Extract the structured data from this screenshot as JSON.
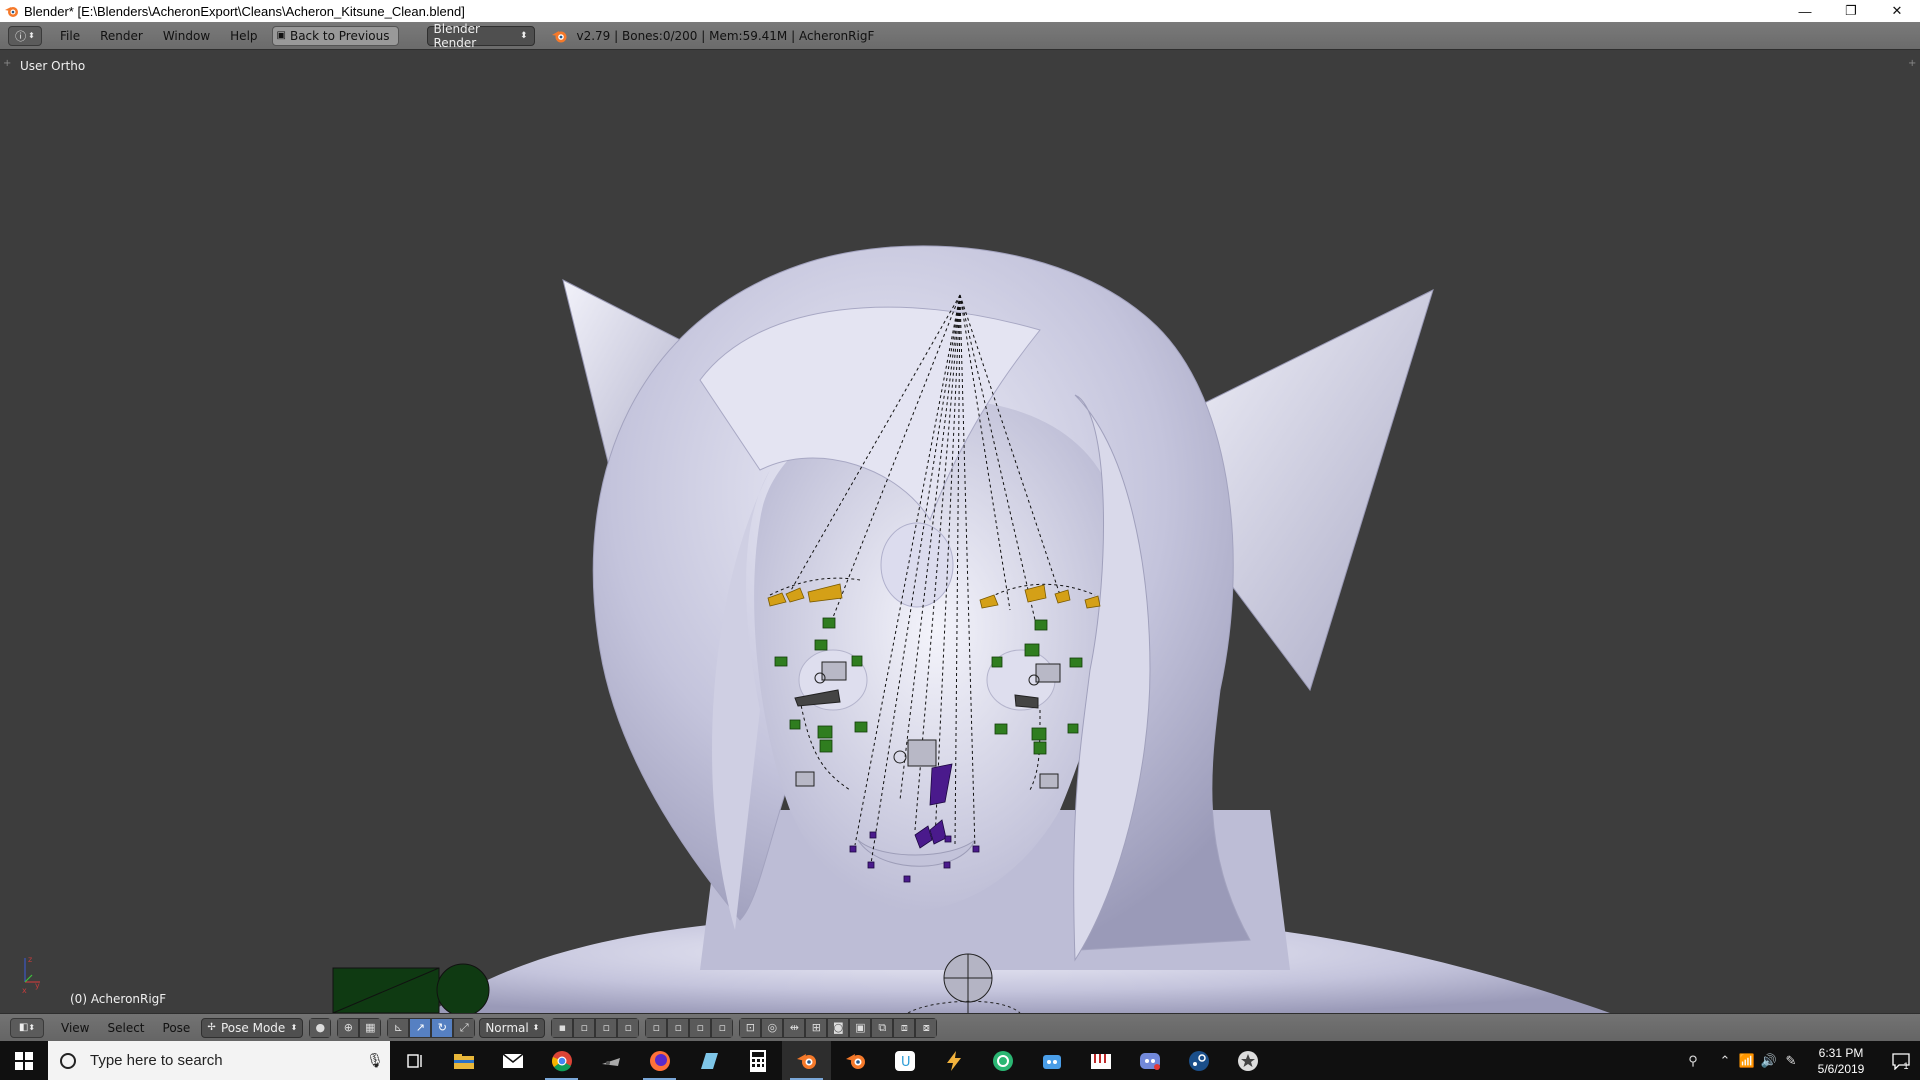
{
  "window": {
    "title": "Blender* [E:\\Blenders\\AcheronExport\\Cleans\\Acheron_Kitsune_Clean.blend]",
    "minimize_glyph": "—",
    "maximize_glyph": "❐",
    "close_glyph": "✕"
  },
  "info_header": {
    "menus": [
      "File",
      "Render",
      "Window",
      "Help"
    ],
    "back_button": "Back to Previous",
    "render_engine": "Blender Render",
    "stats": "v2.79 | Bones:0/200 | Mem:59.41M | AcheronRigF"
  },
  "viewport": {
    "view_label": "User Ortho",
    "object_label": "(0) AcheronRigF",
    "axis_x": "x",
    "axis_y": "y",
    "axis_z": "z"
  },
  "view_header": {
    "menus": [
      "View",
      "Select",
      "Pose"
    ],
    "mode": "Pose Mode",
    "transform_orientation": "Normal"
  },
  "taskbar": {
    "search_placeholder": "Type here to search",
    "apps": [
      "task-view",
      "file-explorer",
      "mail",
      "chrome",
      "game-app",
      "firefox",
      "notepad",
      "calculator",
      "blender",
      "blender-alt",
      "unity",
      "pen-app",
      "circle-app",
      "helper-app",
      "keyboard-app",
      "discord",
      "steam",
      "ball-app"
    ],
    "time": "6:31 PM",
    "date": "5/6/2019",
    "notification_count": "1"
  },
  "colors": {
    "viewport_bg": "#3d3d3d",
    "header_bg": "#727272",
    "bone_yellow": "#d4a017",
    "bone_green": "#2f7d1f",
    "bone_purple": "#4a1a8c",
    "mesh": "#c9c9e0",
    "active_button": "#5680c2"
  }
}
